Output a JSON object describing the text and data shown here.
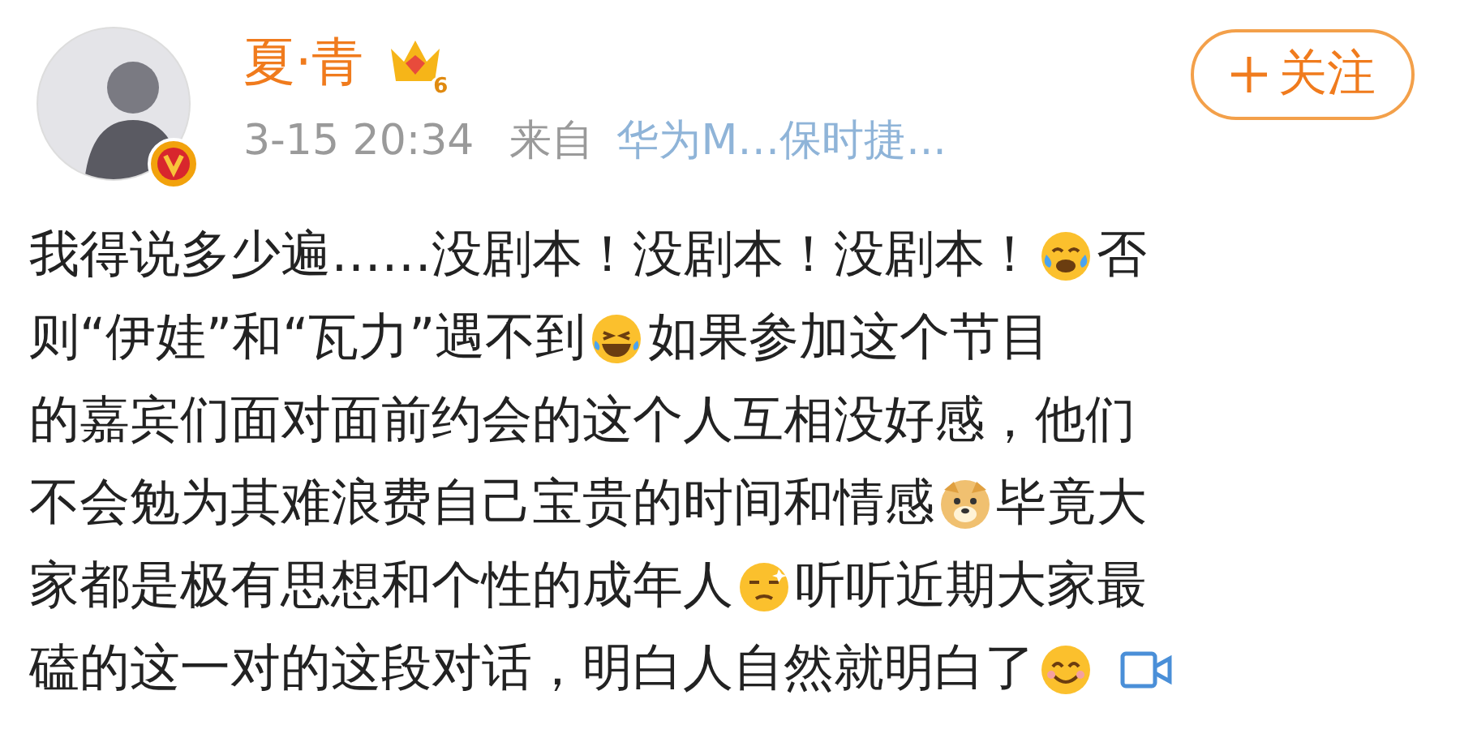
{
  "post": {
    "author": "夏·青",
    "level_badge": "6",
    "verified": true,
    "time": "3-15 20:34",
    "source_prefix": "来自",
    "source": "华为M…保时捷...",
    "follow_label": "关注",
    "body": [
      [
        {
          "kind": "text",
          "text": "我得说多少遍……没剧本！没剧本！没剧本！"
        },
        {
          "kind": "tears"
        },
        {
          "kind": "text",
          "text": "否"
        }
      ],
      [
        {
          "kind": "text",
          "text": "则“伊娃”和“瓦力”遇不到"
        },
        {
          "kind": "laugh"
        },
        {
          "kind": "text",
          "text": "如果参加这个节目"
        }
      ],
      [
        {
          "kind": "text",
          "text": "的嘉宾们面对面前约会的这个人互相没好感，他们"
        }
      ],
      [
        {
          "kind": "text",
          "text": "不会勉为其难浪费自己宝贵的时间和情感"
        },
        {
          "kind": "dog"
        },
        {
          "kind": "text",
          "text": "毕竟大"
        }
      ],
      [
        {
          "kind": "text",
          "text": "家都是极有思想和个性的成年人"
        },
        {
          "kind": "dizzy"
        },
        {
          "kind": "text",
          "text": "听听近期大家最"
        }
      ],
      [
        {
          "kind": "text",
          "text": "磕的这一对的这段对话，明白人自然就明白了"
        },
        {
          "kind": "smile"
        },
        {
          "kind": "video"
        }
      ]
    ]
  }
}
